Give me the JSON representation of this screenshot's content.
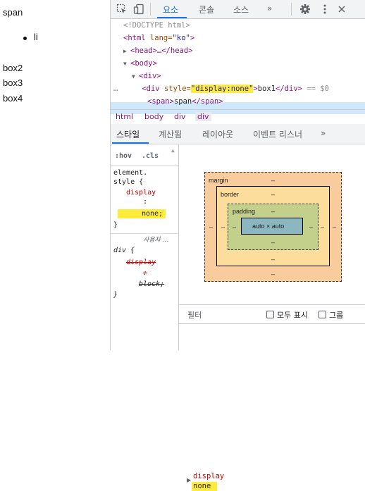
{
  "page": {
    "span_text": "span",
    "li_text": "li",
    "boxes": [
      "box2",
      "box3",
      "box4"
    ]
  },
  "toolbar": {
    "tabs": [
      "요소",
      "콘솔",
      "소스",
      "»"
    ]
  },
  "dom": {
    "doctype": "<!DOCTYPE html>",
    "html_open": "<html",
    "lang_attr": " lang=",
    "lang_val": "\"ko\"",
    "head": "<head>…</head>",
    "body": "<body>",
    "div": "<div>",
    "sel_prefix": "…",
    "sel_div_open": "<div",
    "sel_style_attr": " style=",
    "sel_style_val": "\"display:none\"",
    "sel_text": "box1",
    "sel_div_close": "</div>",
    "sel_suffix": " == $0",
    "span_line_open": "<span>",
    "span_line_text": "span",
    "span_line_close": "</span>"
  },
  "breadcrumb": [
    "html",
    "body",
    "div",
    "div"
  ],
  "subtabs": [
    "스타일",
    "계산됨",
    "레이아웃",
    "이벤트 리스너",
    "»"
  ],
  "styles": {
    "hov": ":hov",
    "cls": ".cls",
    "element_selector": "element.",
    "element_open": "style {",
    "element_prop": "display",
    "element_colon": ":",
    "element_value": "none;",
    "element_close": "}",
    "ua_label": "사용자 …",
    "ua_selector": "div {",
    "ua_prop": "display",
    "ua_colon": ":",
    "ua_value": "block;",
    "ua_close": "}"
  },
  "boxmodel": {
    "margin_label": "margin",
    "border_label": "border",
    "padding_label": "padding",
    "content": "auto × auto",
    "dash": "–",
    "colors": {
      "margin": "#f9cc9d",
      "border": "#fddd9b",
      "padding": "#c3d08b",
      "content": "#8cb6c0"
    }
  },
  "filter": {
    "label": "필터",
    "show_all": "모두 표시",
    "group": "그룹"
  },
  "computed": {
    "prop": "display",
    "value": "none"
  }
}
